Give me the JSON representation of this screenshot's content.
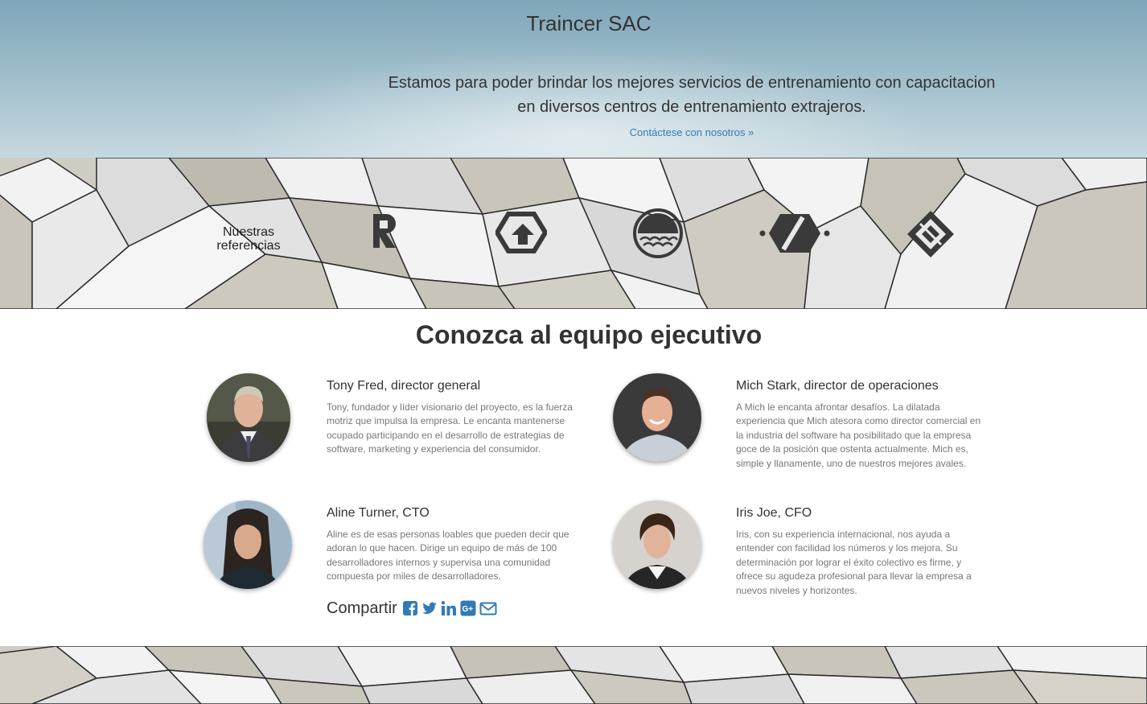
{
  "hero": {
    "title": "Traincer SAC",
    "text": "Estamos para poder brindar los mejores servicios de entrenamiento con capacitacion en diversos centros de entrenamiento extrajeros.",
    "cta": "Contáctese con nosotros »"
  },
  "references": {
    "label": "Nuestras referencias",
    "logos": [
      "r-logo-icon",
      "hexagon-arrow-logo-icon",
      "waves-circle-logo-icon",
      "dot-hexagon-logo-icon",
      "diamond-square-logo-icon"
    ]
  },
  "team": {
    "title": "Conozca al equipo ejecutivo",
    "members": [
      {
        "name": "Tony Fred, director general",
        "bio": "Tony, fundador y líder visionario del proyecto, es la fuerza motriz que impulsa la empresa. Le encanta mantenerse ocupado participando en el desarrollo de estrategias de software, marketing y experiencia del consumidor."
      },
      {
        "name": "Mich Stark, director de operaciones",
        "bio": "A Mich le encanta afrontar desafíos. La dilatada experiencia que Mich atesora como director comercial en la industria del software ha posibilitado que la empresa goce de la posición que ostenta actualmente. Mich es, simple y llanamente, uno de nuestros mejores avales."
      },
      {
        "name": "Aline Turner, CTO",
        "bio": "Aline es de esas personas loables que pueden decir que adoran lo que hacen. Dirige un equipo de más de 100 desarrolladores internos y supervisa una comunidad compuesta por miles de desarrolladores."
      },
      {
        "name": "Iris Joe, CFO",
        "bio": "Iris, con su experiencia internacional, nos ayuda a entender con facilidad los números y los mejora. Su determinación por lograr el éxito colectivo es firme, y ofrece su agudeza profesional para llevar la empresa a nuevos niveles y horizontes."
      }
    ]
  },
  "share": {
    "label": "Compartir",
    "icons": [
      "facebook-icon",
      "twitter-icon",
      "linkedin-icon",
      "google-plus-icon",
      "envelope-icon"
    ]
  },
  "colors": {
    "link": "#337ab7",
    "text": "#333333",
    "muted": "#777777"
  }
}
